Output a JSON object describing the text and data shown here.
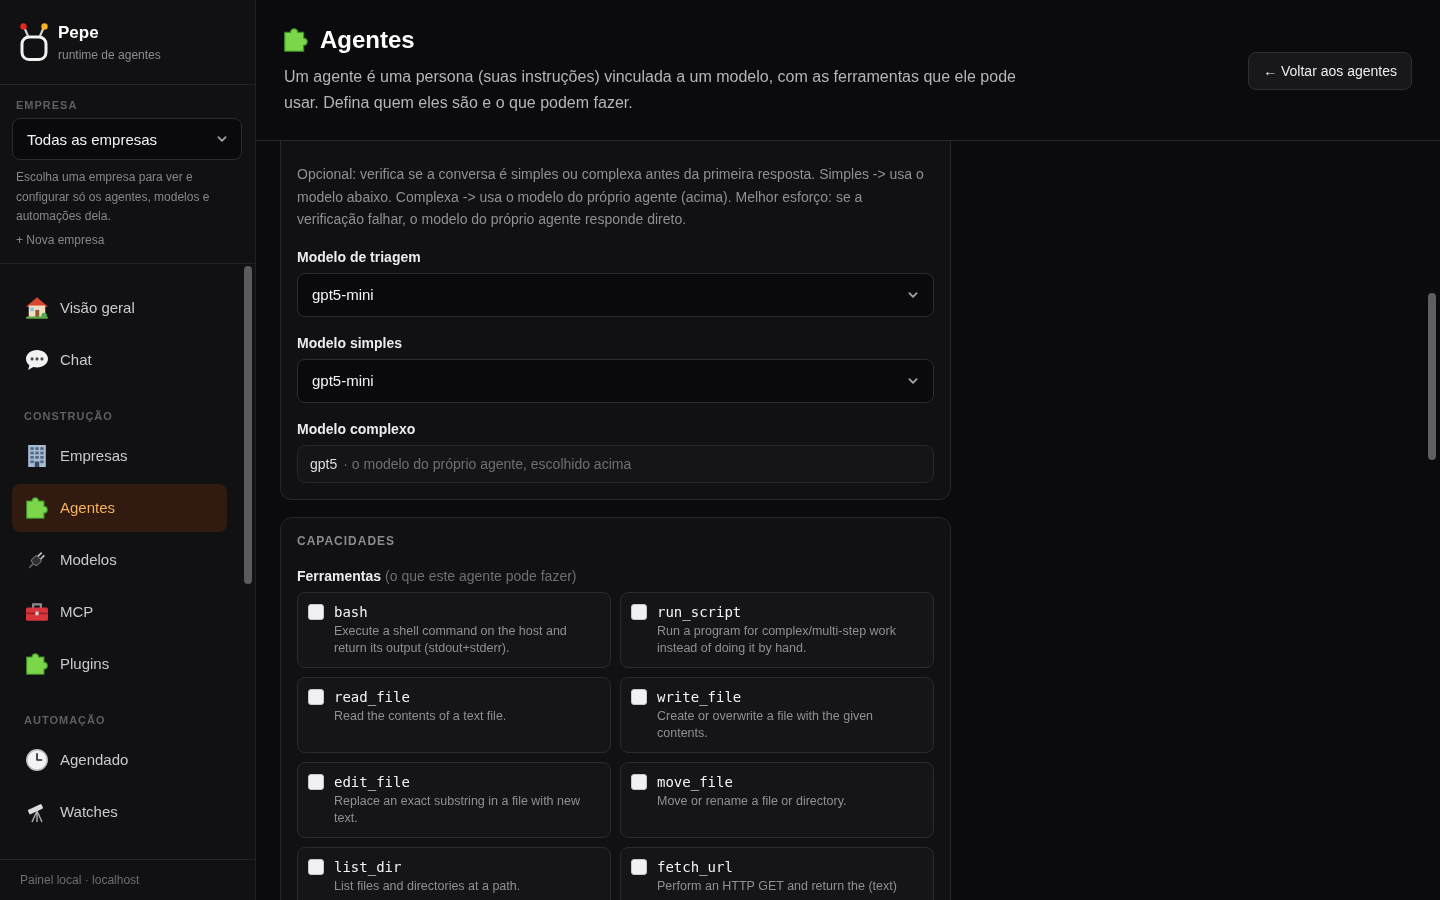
{
  "sidebar": {
    "brand": {
      "name": "Pepe",
      "subtitle": "runtime de agentes"
    },
    "company": {
      "label": "EMPRESA",
      "value": "Todas as empresas",
      "help": "Escolha uma empresa para ver e configurar só os agentes, modelos e automações dela.",
      "new_link": "+ Nova empresa"
    },
    "nav_sections": [
      {
        "items": [
          {
            "label": "Visão geral",
            "selected": false
          },
          {
            "label": "Chat",
            "selected": false
          }
        ]
      },
      {
        "title": "CONSTRUÇÃO",
        "items": [
          {
            "label": "Empresas",
            "selected": false
          },
          {
            "label": "Agentes",
            "selected": true
          },
          {
            "label": "Modelos",
            "selected": false
          },
          {
            "label": "MCP",
            "selected": false
          },
          {
            "label": "Plugins",
            "selected": false
          }
        ]
      },
      {
        "title": "AUTOMAÇÃO",
        "items": [
          {
            "label": "Agendado",
            "selected": false
          },
          {
            "label": "Watches",
            "selected": false
          }
        ]
      }
    ],
    "footer": "Painel local · localhost"
  },
  "header": {
    "title": "Agentes",
    "description": "Um agente é uma persona (suas instruções) vinculada a um modelo, com as ferramentas que ele pode usar. Defina quem eles são e o que podem fazer.",
    "back_button": "← Voltar aos agentes"
  },
  "routing": {
    "description": "Opcional: verifica se a conversa é simples ou complexa antes da primeira resposta. Simples -> usa o modelo abaixo. Complexa -> usa o modelo do próprio agente (acima). Melhor esforço: se a verificação falhar, o modelo do próprio agente responde direto.",
    "fields": [
      {
        "label": "Modelo de triagem",
        "kind": "select",
        "value": "gpt5-mini"
      },
      {
        "label": "Modelo simples",
        "kind": "select",
        "value": "gpt5-mini"
      },
      {
        "label": "Modelo complexo",
        "kind": "readonly",
        "value": "gpt5",
        "note": "· o modelo do próprio agente, escolhido acima"
      }
    ]
  },
  "capabilities": {
    "title": "CAPACIDADES",
    "tools_label": "Ferramentas",
    "tools_hint": "(o que este agente pode fazer)",
    "tools": [
      {
        "name": "bash",
        "description": "Execute a shell command on the host and return its output (stdout+stderr).",
        "checked": false
      },
      {
        "name": "run_script",
        "description": "Run a program for complex/multi-step work instead of doing it by hand.",
        "checked": false
      },
      {
        "name": "read_file",
        "description": "Read the contents of a text file.",
        "checked": false
      },
      {
        "name": "write_file",
        "description": "Create or overwrite a file with the given contents.",
        "checked": false
      },
      {
        "name": "edit_file",
        "description": "Replace an exact substring in a file with new text.",
        "checked": false
      },
      {
        "name": "move_file",
        "description": "Move or rename a file or directory.",
        "checked": false
      },
      {
        "name": "list_dir",
        "description": "List files and directories at a path.",
        "checked": false
      },
      {
        "name": "fetch_url",
        "description": "Perform an HTTP GET and return the (text)",
        "checked": false
      }
    ]
  }
}
